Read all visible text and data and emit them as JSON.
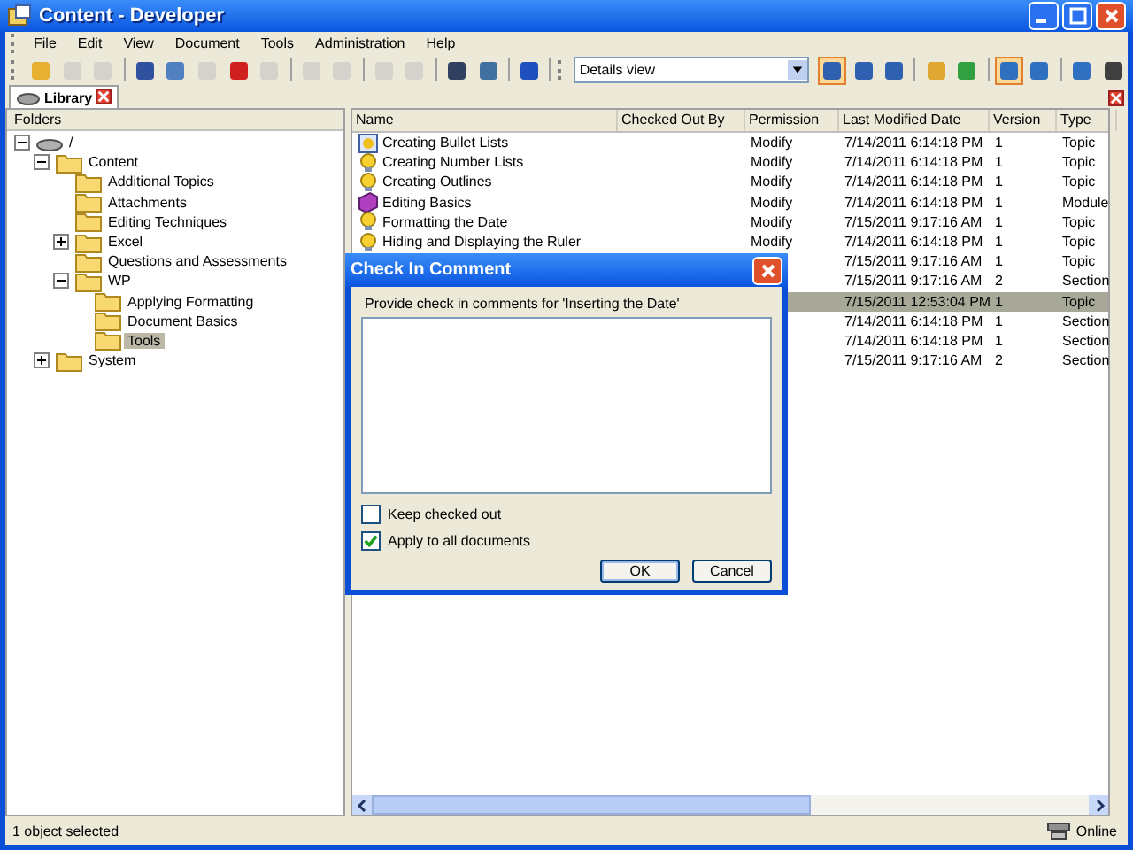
{
  "window": {
    "title": "Content - Developer"
  },
  "menu": [
    "File",
    "Edit",
    "View",
    "Document",
    "Tools",
    "Administration",
    "Help"
  ],
  "toolbar": [
    {
      "kind": "open",
      "disabled": false
    },
    {
      "kind": "save",
      "disabled": true
    },
    {
      "kind": "print",
      "disabled": true
    },
    {
      "kind": "sep"
    },
    {
      "kind": "cut",
      "disabled": false
    },
    {
      "kind": "copy",
      "disabled": false
    },
    {
      "kind": "paste",
      "disabled": true
    },
    {
      "kind": "delete",
      "disabled": false
    },
    {
      "kind": "properties",
      "disabled": true
    },
    {
      "kind": "sep"
    },
    {
      "kind": "undo",
      "disabled": true
    },
    {
      "kind": "redo",
      "disabled": true
    },
    {
      "kind": "sep"
    },
    {
      "kind": "plus",
      "disabled": true
    },
    {
      "kind": "minus",
      "disabled": true
    },
    {
      "kind": "sep"
    },
    {
      "kind": "find",
      "disabled": false
    },
    {
      "kind": "spell",
      "disabled": false
    },
    {
      "kind": "sep"
    },
    {
      "kind": "help",
      "disabled": false
    }
  ],
  "view_select": {
    "value": "Details view"
  },
  "toolbar2": [
    {
      "kind": "details",
      "selected": true
    },
    {
      "kind": "split-h",
      "selected": false
    },
    {
      "kind": "split-v",
      "selected": false
    },
    {
      "kind": "sep"
    },
    {
      "kind": "folder-up",
      "selected": false
    },
    {
      "kind": "refresh",
      "selected": false
    },
    {
      "kind": "sep"
    },
    {
      "kind": "checkout",
      "selected": true
    },
    {
      "kind": "checkin",
      "selected": false
    },
    {
      "kind": "sep"
    },
    {
      "kind": "download",
      "selected": false
    },
    {
      "kind": "info",
      "selected": false
    }
  ],
  "tabs": [
    {
      "label": "Library",
      "selected": true
    }
  ],
  "folders": {
    "title": "Folders",
    "tree": [
      {
        "label": "/",
        "kind": "server",
        "expanded": true,
        "selected": false,
        "children": [
          {
            "label": "Content",
            "kind": "folder",
            "expanded": true,
            "selected": false,
            "children": [
              {
                "label": "Additional Topics",
                "kind": "folder",
                "selected": false
              },
              {
                "label": "Attachments",
                "kind": "folder",
                "selected": false
              },
              {
                "label": "Editing Techniques",
                "kind": "folder",
                "selected": false
              },
              {
                "label": "Excel",
                "kind": "folder",
                "expanded": false,
                "selected": false,
                "has_children": true
              },
              {
                "label": "Questions and Assessments",
                "kind": "folder",
                "selected": false
              },
              {
                "label": "WP",
                "kind": "folder",
                "expanded": true,
                "selected": false,
                "children": [
                  {
                    "label": "Applying Formatting",
                    "kind": "folder",
                    "selected": false
                  },
                  {
                    "label": "Document Basics",
                    "kind": "folder",
                    "selected": false
                  },
                  {
                    "label": "Tools",
                    "kind": "folder",
                    "selected": true
                  }
                ]
              }
            ]
          },
          {
            "label": "System",
            "kind": "folder",
            "expanded": false,
            "selected": false,
            "has_children": true
          }
        ]
      }
    ]
  },
  "table": {
    "columns": [
      "Name",
      "Checked Out By",
      "Permission",
      "Last Modified Date",
      "Version",
      "Type"
    ],
    "rows": [
      {
        "name": "Creating Bullet Lists",
        "kind": "topic-doc",
        "permission": "Modify",
        "date": "7/14/2011 6:14:18 PM",
        "version": "1",
        "type": "Topic",
        "selected": false
      },
      {
        "name": "Creating Number Lists",
        "kind": "topic",
        "permission": "Modify",
        "date": "7/14/2011 6:14:18 PM",
        "version": "1",
        "type": "Topic",
        "selected": false
      },
      {
        "name": "Creating Outlines",
        "kind": "topic",
        "permission": "Modify",
        "date": "7/14/2011 6:14:18 PM",
        "version": "1",
        "type": "Topic",
        "selected": false
      },
      {
        "name": "Editing Basics",
        "kind": "module",
        "permission": "Modify",
        "date": "7/14/2011 6:14:18 PM",
        "version": "1",
        "type": "Module",
        "selected": false
      },
      {
        "name": "Formatting the Date",
        "kind": "topic",
        "permission": "Modify",
        "date": "7/15/2011 9:17:16 AM",
        "version": "1",
        "type": "Topic",
        "selected": false
      },
      {
        "name": "Hiding and Displaying the Ruler",
        "kind": "topic",
        "permission": "Modify",
        "date": "7/14/2011 6:14:18 PM",
        "version": "1",
        "type": "Topic",
        "selected": false
      },
      {
        "date": "7/15/2011 9:17:16 AM",
        "version": "1",
        "type": "Topic",
        "selected": false
      },
      {
        "date": "7/15/2011 9:17:16 AM",
        "version": "2",
        "type": "Section",
        "selected": false
      },
      {
        "date": "7/15/2011 12:53:04 PM",
        "version": "1",
        "type": "Topic",
        "selected": true
      },
      {
        "date": "7/14/2011 6:14:18 PM",
        "version": "1",
        "type": "Section",
        "selected": false
      },
      {
        "date": "7/14/2011 6:14:18 PM",
        "version": "1",
        "type": "Section",
        "selected": false
      },
      {
        "date": "7/15/2011 9:17:16 AM",
        "version": "2",
        "type": "Section",
        "selected": false
      }
    ]
  },
  "dialog": {
    "title": "Check In Comment",
    "prompt": "Provide check in comments for 'Inserting the Date'",
    "checkboxes": [
      {
        "label": "Keep checked out",
        "checked": false
      },
      {
        "label": "Apply to all documents",
        "checked": true
      }
    ],
    "buttons": [
      "OK",
      "Cancel"
    ]
  },
  "status_bar": {
    "message": "1 object selected",
    "connection": "Online"
  }
}
